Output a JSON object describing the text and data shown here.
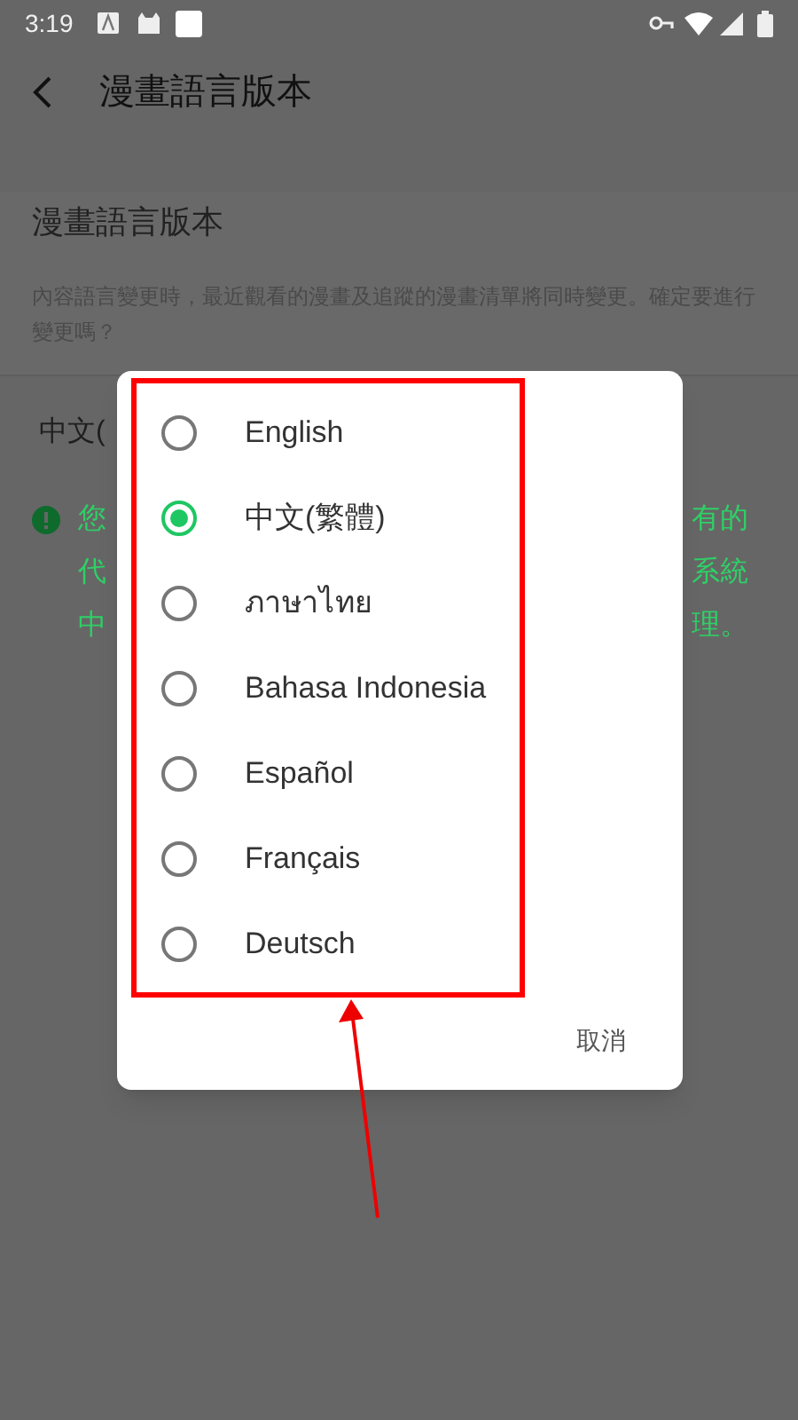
{
  "status_bar": {
    "time": "3:19"
  },
  "header": {
    "title": "漫畫語言版本"
  },
  "section": {
    "title": "漫畫語言版本",
    "description": "內容語言變更時，最近觀看的漫畫及追蹤的漫畫清單將同時變更。確定要進行變更嗎？"
  },
  "current_value": {
    "visible_text": "中文("
  },
  "notice": {
    "lines": [
      {
        "visible_left": "您",
        "visible_right": "有的"
      },
      {
        "visible_left": "代",
        "visible_right": "系統"
      },
      {
        "visible_left": "中",
        "visible_right": "理。"
      }
    ]
  },
  "dialog": {
    "options": [
      {
        "label": "English",
        "selected": false
      },
      {
        "label": "中文(繁體)",
        "selected": true
      },
      {
        "label": "ภาษาไทย",
        "selected": false
      },
      {
        "label": "Bahasa Indonesia",
        "selected": false
      },
      {
        "label": "Español",
        "selected": false
      },
      {
        "label": "Français",
        "selected": false
      },
      {
        "label": "Deutsch",
        "selected": false
      }
    ],
    "cancel": "取消"
  }
}
